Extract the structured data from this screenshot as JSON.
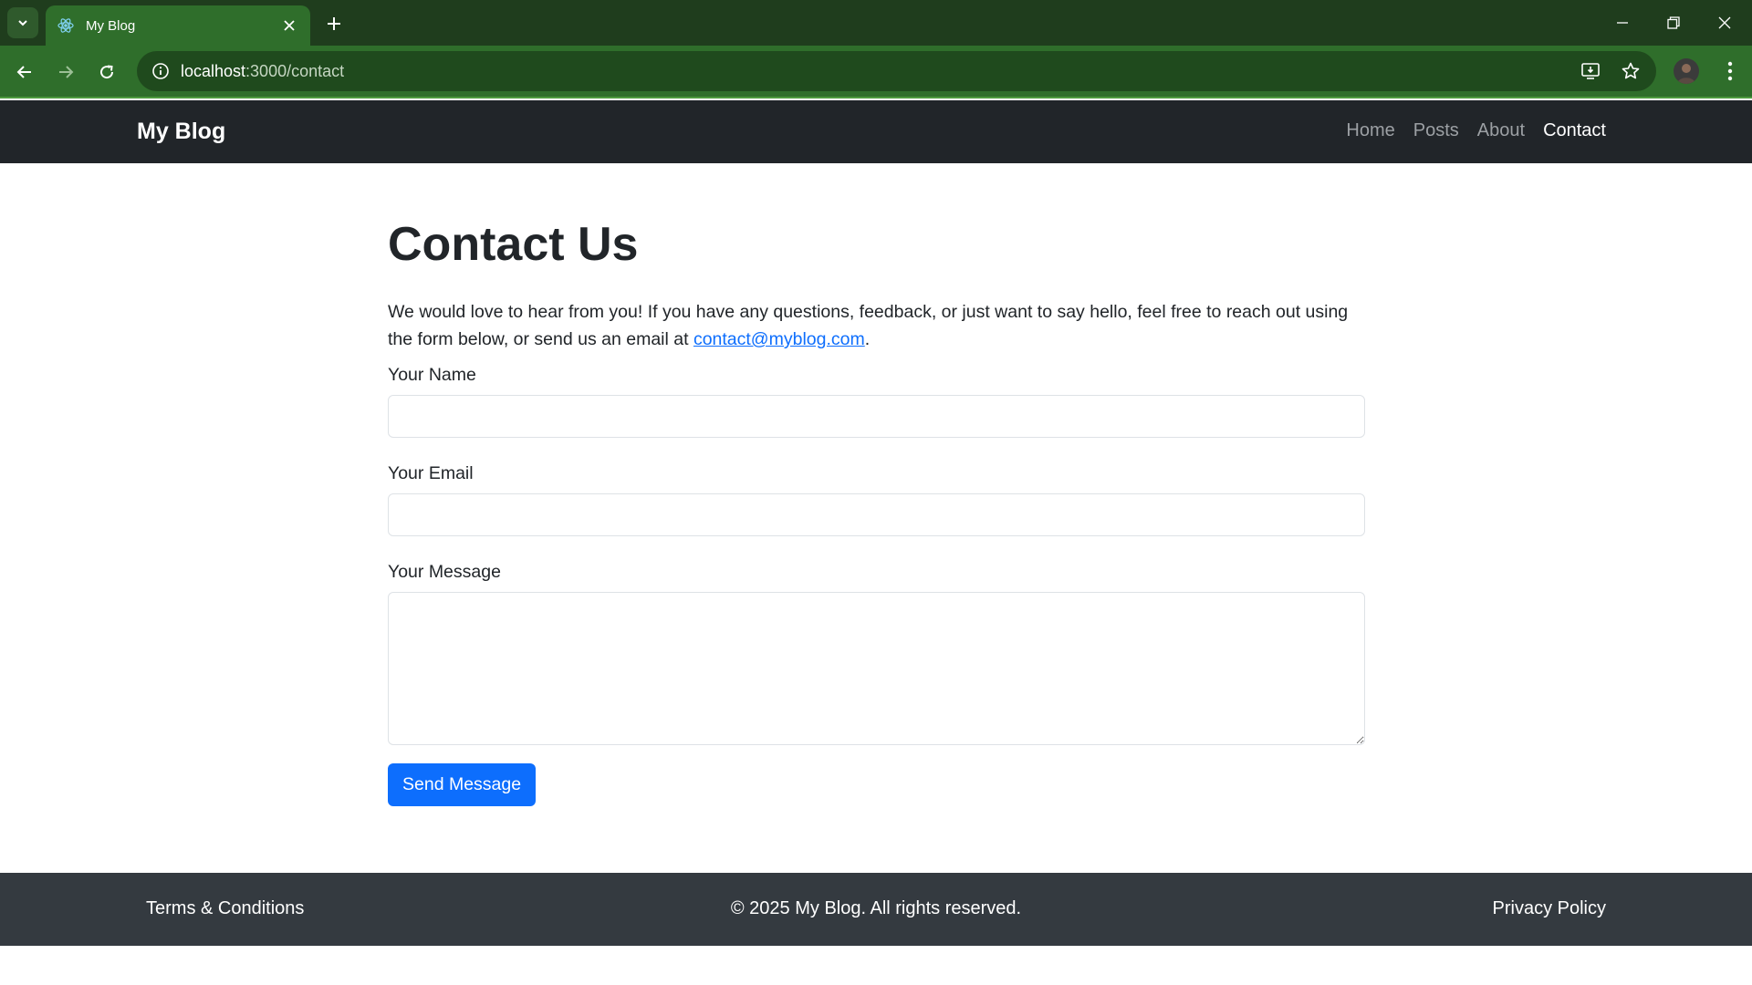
{
  "browser": {
    "tab_title": "My Blog",
    "url_host": "localhost",
    "url_rest": ":3000/contact"
  },
  "site": {
    "brand": "My Blog",
    "nav": [
      {
        "label": "Home",
        "active": false
      },
      {
        "label": "Posts",
        "active": false
      },
      {
        "label": "About",
        "active": false
      },
      {
        "label": "Contact",
        "active": true
      }
    ]
  },
  "contact": {
    "title": "Contact Us",
    "intro_text": "We would love to hear from you! If you have any questions, feedback, or just want to say hello, feel free to reach out using the form below, or send us an email at ",
    "email": "contact@myblog.com",
    "intro_end": ".",
    "form": {
      "name_label": "Your Name",
      "name_value": "",
      "email_label": "Your Email",
      "email_value": "",
      "message_label": "Your Message",
      "message_value": "",
      "submit_label": "Send Message"
    }
  },
  "footer": {
    "left": "Terms & Conditions",
    "center": "© 2025 My Blog. All rights reserved.",
    "right": "Privacy Policy"
  },
  "colors": {
    "tabstrip": "#1f3d1d",
    "toolbar": "#2f6e2b",
    "navbar": "#212529",
    "footer": "#343a40",
    "primary": "#0d6efd"
  }
}
